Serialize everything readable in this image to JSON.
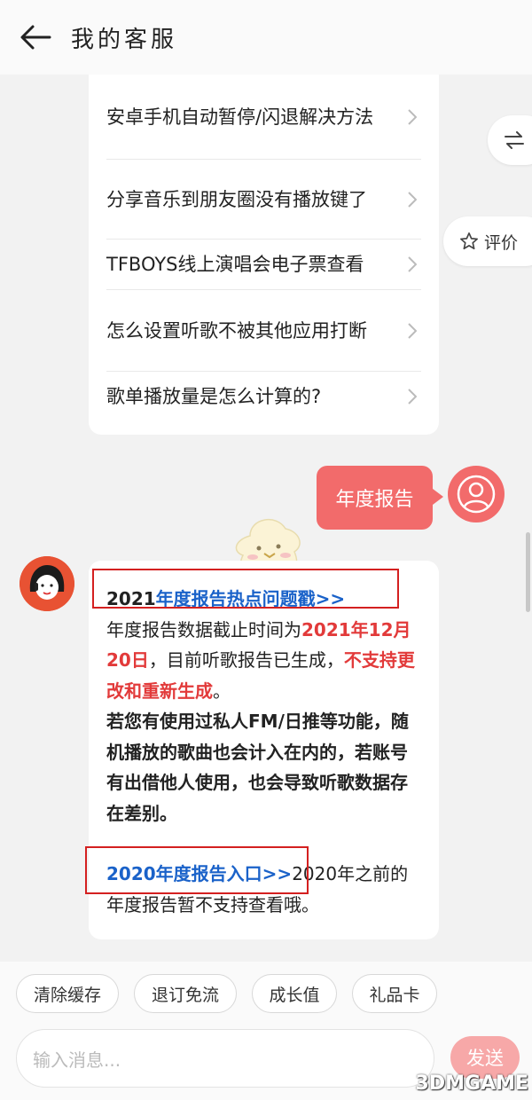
{
  "header": {
    "title": "我的客服"
  },
  "faq": {
    "items": [
      {
        "label": "安卓手机自动暂停/闪退解决方法"
      },
      {
        "label": "分享音乐到朋友圈没有播放键了"
      },
      {
        "label": "TFBOYS线上演唱会电子票查看"
      },
      {
        "label": "怎么设置听歌不被其他应用打断"
      },
      {
        "label": "歌单播放量是怎么计算的?"
      }
    ]
  },
  "side": {
    "rate_label": "评价"
  },
  "user_message": {
    "text": "年度报告"
  },
  "bot_message": {
    "line1_year": "2021",
    "line1_link": "年度报告热点问题戳>>",
    "p1_start": "年度报告数据截止时间为",
    "p1_red": "2021年12月20日",
    "p1_mid": "，目前听歌报告已生成，",
    "p1_red2": "不支持更改和重新生成",
    "p1_end": "。",
    "p2": "若您有使用过私人FM/日推等功能，随机播放的歌曲也会计入在内的，若账号有出借他人使用，也会导致听歌数据存在差别。",
    "p3_link": "2020年度报告入口>>",
    "p3_rest": "2020年之前的年度报告暂不支持查看哦。"
  },
  "quick_replies": [
    "清除缓存",
    "退订免流",
    "成长值",
    "礼品卡"
  ],
  "composer": {
    "placeholder": "输入消息...",
    "send_label": "发送"
  },
  "watermark": "3DMGAME",
  "colors": {
    "accent": "#f26b6b",
    "link": "#1a62c9",
    "highlight_red": "#e23a3a"
  }
}
